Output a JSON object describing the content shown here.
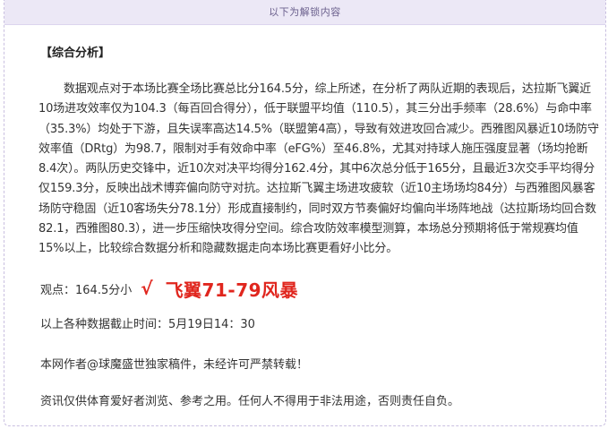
{
  "banner": {
    "text": "以下为解锁内容"
  },
  "section": {
    "title": "【综合分析】"
  },
  "analysis": {
    "paragraph": "数据观点对于本场比赛全场比赛总比分164.5分，综上所述，在分析了两队近期的表现后，达拉斯飞翼近10场进攻效率仅为104.3（每百回合得分），低于联盟平均值（110.5），其三分出手频率（28.6%）与命中率（35.3%）均处于下游，且失误率高达14.5%（联盟第4高），导致有效进攻回合减少。西雅图风暴近10场防守效率值（DRtg）为98.7，限制对手有效命中率（eFG%）至46.8%，尤其对持球人施压强度显著（场均抢断8.4次）。两队历史交锋中，近10次对决平均得分162.4分，其中6次总分低于165分，且最近3次交手平均得分仅159.3分，反映出战术博弈偏向防守对抗。达拉斯飞翼主场进攻疲软（近10主场场均84分）与西雅图风暴客场防守稳固（近10客场失分78.1分）形成直接制约，同时双方节奏偏好均偏向半场阵地战（达拉斯场均回合数82.1，西雅图80.3），进一步压缩快攻得分空间。综合攻防效率模型测算，本场总分预期将低于常规赛均值15%以上，比较综合数据分析和隐藏数据走向本场比赛更看好小比分。"
  },
  "opinion": {
    "label": "观点：164.5分小",
    "check_mark": "√",
    "highlight": "飞翼71-79风暴"
  },
  "cutoff": {
    "text": "以上各种数据截止时间：5月19日14：30"
  },
  "copyright": {
    "text": "本网作者@球魔盛世独家稿件，未经许可严禁转载！"
  },
  "disclaimer": {
    "text": "资讯仅供体育爱好者浏览、参考之用。任何人不得用于非法用途，否则责任自负。"
  },
  "colors": {
    "banner_bg": "#ece8f6",
    "banner_text": "#6a5f8c",
    "highlight_red": "#e0261e",
    "body_text": "#333333"
  }
}
